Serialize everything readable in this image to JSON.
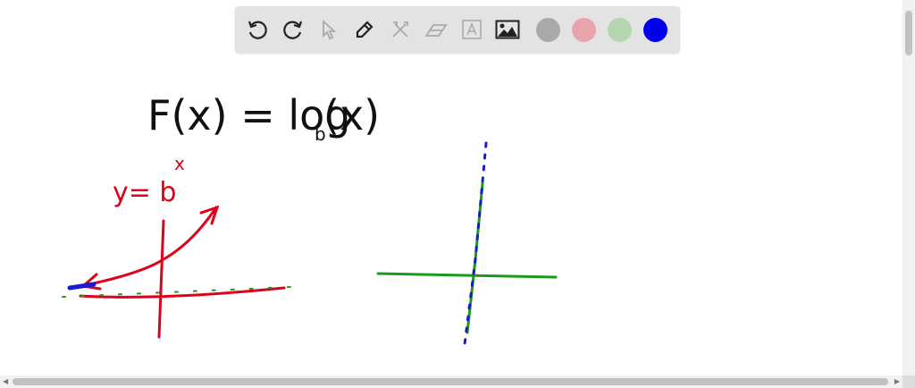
{
  "toolbar": {
    "tools": [
      "undo-icon",
      "redo-icon",
      "select-icon",
      "pen-icon",
      "tools-icon",
      "eraser-icon",
      "text-icon",
      "image-icon"
    ],
    "colors": [
      "#a9a9a9",
      "#e8a4ab",
      "#b3d5b0",
      "#0000ee"
    ]
  },
  "whiteboard": {
    "equation": "F(x) = log",
    "equation_sub": "b",
    "equation_tail": "(x)",
    "label_left": "y= b",
    "label_left_sup": "x"
  },
  "colors": {
    "ink": "#111111",
    "red": "#e0001b",
    "green": "#1a9a1a",
    "blue": "#1a1ad0"
  }
}
